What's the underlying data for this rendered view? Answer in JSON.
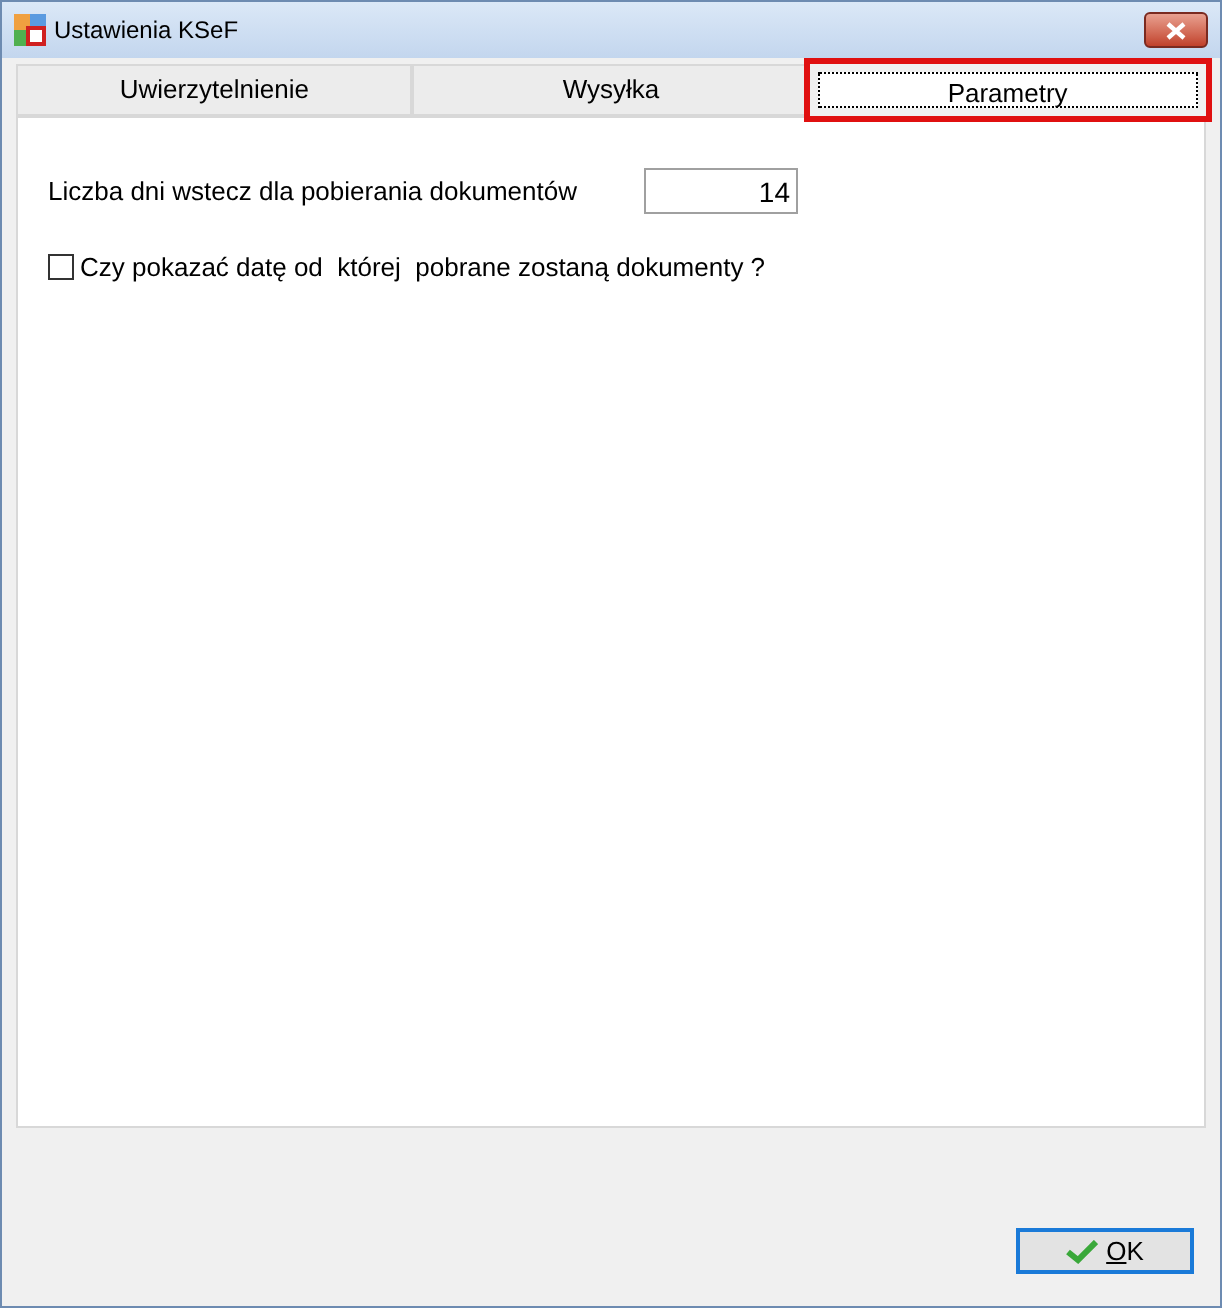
{
  "window": {
    "title": "Ustawienia KSeF"
  },
  "tabs": [
    {
      "label": "Uwierzytelnienie",
      "selected": false,
      "highlighted": false
    },
    {
      "label": "Wysyłka",
      "selected": false,
      "highlighted": false
    },
    {
      "label": "Parametry",
      "selected": true,
      "highlighted": true
    }
  ],
  "days_field": {
    "label": "Liczba dni wstecz dla pobierania dokumentów",
    "value": "14"
  },
  "show_date_checkbox": {
    "label": "Czy pokazać datę od  której  pobrane zostaną dokumenty ?",
    "checked": false
  },
  "ok_button": {
    "label": "OK",
    "first_letter_underlined": true
  }
}
